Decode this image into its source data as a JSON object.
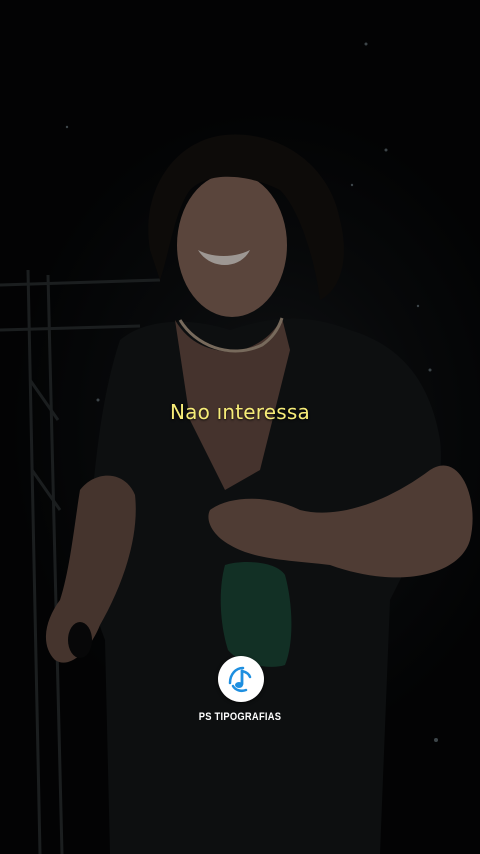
{
  "video": {
    "lyric_caption": "Nao ınteressa"
  },
  "watermark": {
    "brand_name": "PS TIPOGRAFIAS",
    "icon": "music-note-icon",
    "accent_color": "#1e8fe0"
  }
}
